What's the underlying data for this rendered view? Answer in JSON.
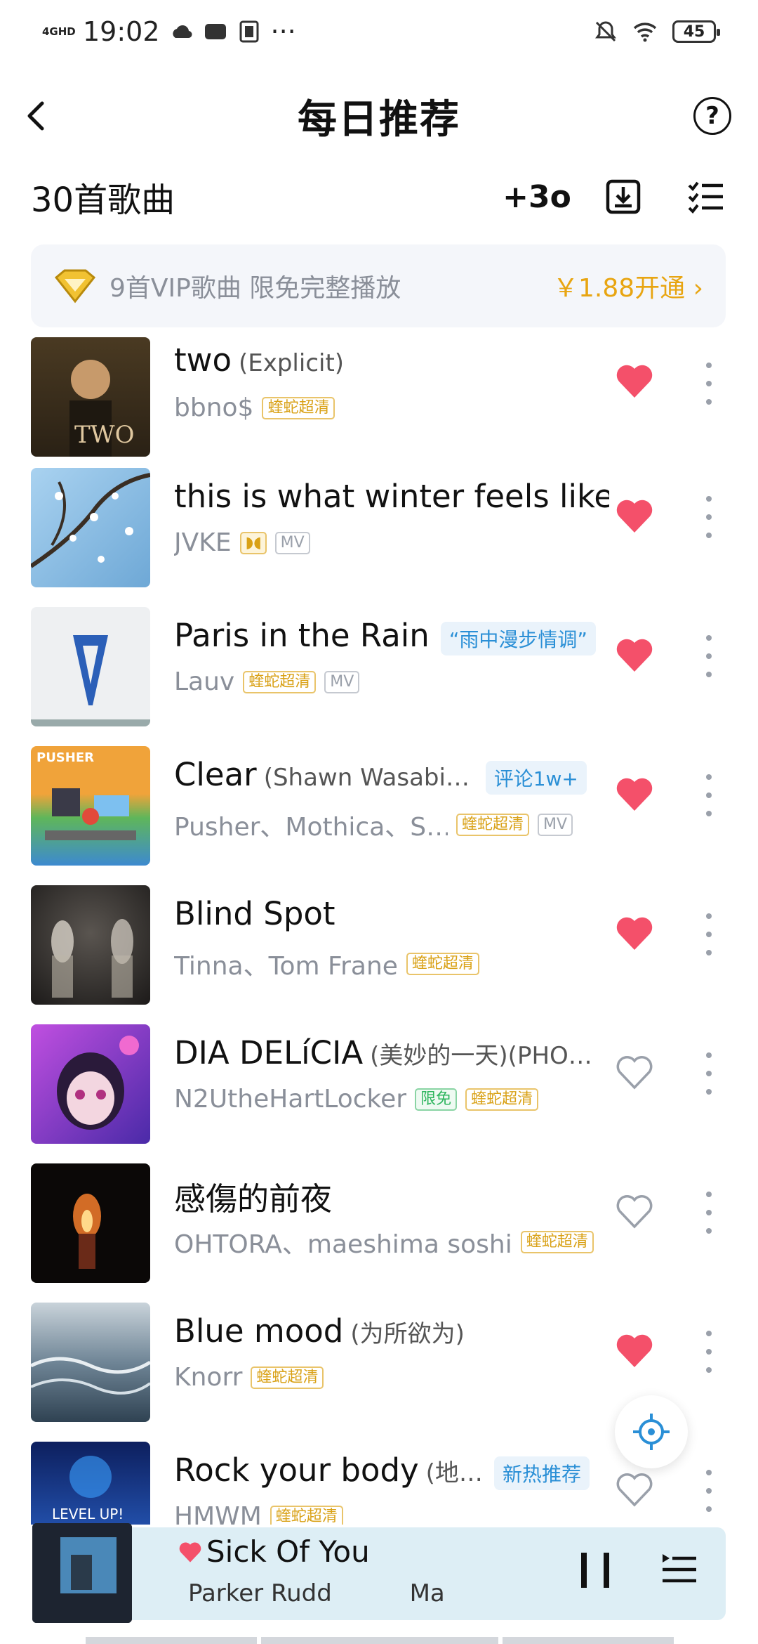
{
  "status_bar": {
    "network": "4GHD",
    "time": "19:02",
    "battery": "45"
  },
  "header": {
    "title": "每日推荐",
    "help": "?"
  },
  "subheader": {
    "count": "30首歌曲",
    "play_icon_label": "+3o"
  },
  "vip": {
    "text": "9首VIP歌曲 限免完整播放",
    "price": "￥1.88开通 ›"
  },
  "songs": [
    {
      "title": "two",
      "subtitle": "(Explicit)",
      "artist": "bbno$",
      "badges": [
        "蝰蛇超清"
      ],
      "liked": true
    },
    {
      "title": "this is what winter feels like",
      "subtitle": "",
      "artist": "JVKE",
      "badges": [
        "MV"
      ],
      "liked": true
    },
    {
      "title": "Paris in the Rain",
      "subtitle": "",
      "tag": "“雨中漫步情调”",
      "artist": "Lauv",
      "badges": [
        "蝰蛇超清",
        "MV"
      ],
      "liked": true
    },
    {
      "title": "Clear",
      "subtitle": "(Shawn Wasabi …",
      "tag": "评论1w+",
      "artist": "Pusher、Mothica、S…",
      "badges": [
        "蝰蛇超清",
        "MV"
      ],
      "liked": true
    },
    {
      "title": "Blind Spot",
      "subtitle": "",
      "artist": "Tinna、Tom Frane",
      "badges": [
        "蝰蛇超清"
      ],
      "liked": true
    },
    {
      "title": "DIA DELíCIA",
      "subtitle": "(美妙的一天)(PHO…",
      "artist": "N2UtheHartLocker",
      "badges": [
        "限免",
        "蝰蛇超清"
      ],
      "liked": false
    },
    {
      "title": "感傷的前夜",
      "subtitle": "",
      "artist": "OHTORA、maeshima soshi",
      "badges": [
        "蝰蛇超清"
      ],
      "liked": false
    },
    {
      "title": "Blue mood",
      "subtitle": "(为所欲为)",
      "artist": "Knorr",
      "badges": [
        "蝰蛇超清"
      ],
      "liked": true
    },
    {
      "title": "Rock your body",
      "subtitle": "(地…",
      "tag": "新热推荐",
      "artist": "HMWM",
      "badges": [
        "蝰蛇超清"
      ],
      "liked": false
    }
  ],
  "player": {
    "title": "Sick Of You",
    "artist": "Parker Rudd",
    "artist_extra": "Ma"
  },
  "colors": {
    "heart": "#f4506a",
    "vip_gold": "#e8a511",
    "tag_blue": "#2a8fd6",
    "player_bg": "#ddeef5"
  }
}
